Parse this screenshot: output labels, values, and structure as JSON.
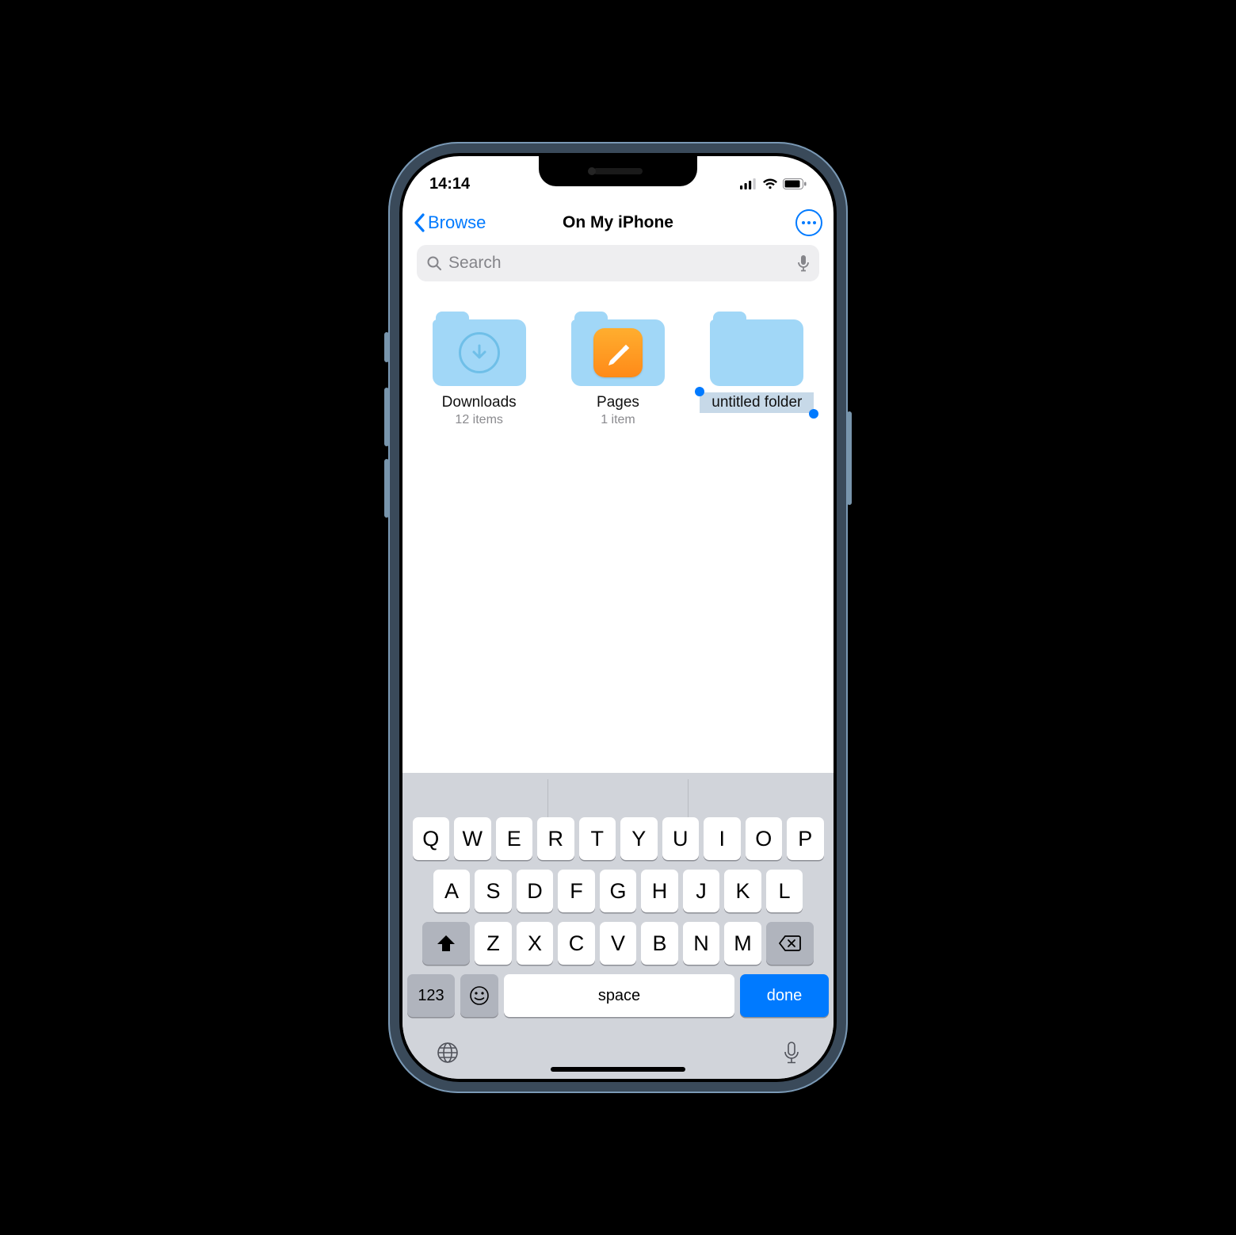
{
  "status": {
    "time": "14:14"
  },
  "nav": {
    "back_label": "Browse",
    "title": "On My iPhone"
  },
  "search": {
    "placeholder": "Search"
  },
  "folders": [
    {
      "name": "Downloads",
      "sub": "12 items",
      "kind": "downloads"
    },
    {
      "name": "Pages",
      "sub": "1 item",
      "kind": "pages"
    },
    {
      "name": "untitled folder",
      "sub": "",
      "kind": "new",
      "editing": true
    }
  ],
  "keyboard": {
    "row1": [
      "Q",
      "W",
      "E",
      "R",
      "T",
      "Y",
      "U",
      "I",
      "O",
      "P"
    ],
    "row2": [
      "A",
      "S",
      "D",
      "F",
      "G",
      "H",
      "J",
      "K",
      "L"
    ],
    "row3": [
      "Z",
      "X",
      "C",
      "V",
      "B",
      "N",
      "M"
    ],
    "numLabel": "123",
    "spaceLabel": "space",
    "doneLabel": "done"
  }
}
